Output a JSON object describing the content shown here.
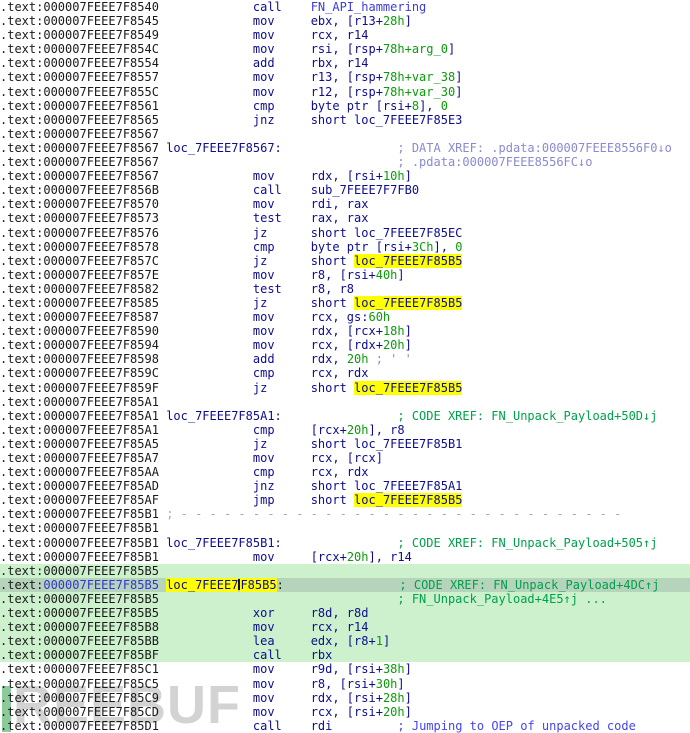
{
  "watermark": {
    "text": "REEBUF"
  },
  "colors": {
    "mnemonic": "#0d0d8e",
    "number": "#0a9b0a",
    "user_name": "#3d3dd3",
    "auto_xref": "#8a8ad0",
    "code_xref": "#00a14b",
    "manual_comment": "#4545ef",
    "highlight_bg": "#ffff00",
    "row_highlight": "#cdf1cd",
    "current_row": "#b6d4bc"
  },
  "listing": {
    "lines": [
      {
        "addr": ".text:000007FEEE7F8540",
        "mnem": "call",
        "ops": [
          [
            "FN_API_hammering",
            "u"
          ]
        ]
      },
      {
        "addr": ".text:000007FEEE7F8545",
        "mnem": "mov",
        "ops": [
          [
            "ebx, [r13+",
            "m"
          ],
          [
            "28h",
            "n"
          ],
          [
            "]",
            "m"
          ]
        ]
      },
      {
        "addr": ".text:000007FEEE7F8549",
        "mnem": "mov",
        "ops": [
          [
            "rcx, r14",
            "m"
          ]
        ]
      },
      {
        "addr": ".text:000007FEEE7F854C",
        "mnem": "mov",
        "ops": [
          [
            "rsi, [rsp+",
            "m"
          ],
          [
            "78h+arg_0",
            "n"
          ],
          [
            "]",
            "m"
          ]
        ]
      },
      {
        "addr": ".text:000007FEEE7F8554",
        "mnem": "add",
        "ops": [
          [
            "rbx, r14",
            "m"
          ]
        ]
      },
      {
        "addr": ".text:000007FEEE7F8557",
        "mnem": "mov",
        "ops": [
          [
            "r13, [rsp+",
            "m"
          ],
          [
            "78h+var_38",
            "n"
          ],
          [
            "]",
            "m"
          ]
        ]
      },
      {
        "addr": ".text:000007FEEE7F855C",
        "mnem": "mov",
        "ops": [
          [
            "r12, [rsp+",
            "m"
          ],
          [
            "78h+var_30",
            "n"
          ],
          [
            "]",
            "m"
          ]
        ]
      },
      {
        "addr": ".text:000007FEEE7F8561",
        "mnem": "cmp",
        "ops": [
          [
            "byte ptr [rsi+",
            "m"
          ],
          [
            "8",
            "n"
          ],
          [
            "], ",
            "m"
          ],
          [
            "0",
            "n"
          ]
        ]
      },
      {
        "addr": ".text:000007FEEE7F8565",
        "mnem": "jnz",
        "ops": [
          [
            "short loc_7FEEE7F85E3",
            "m"
          ]
        ]
      },
      {
        "addr": ".text:000007FEEE7F8567"
      },
      {
        "addr": ".text:000007FEEE7F8567",
        "label": [
          [
            "loc_7FEEE7F8567:",
            "m"
          ]
        ],
        "cmt": [
          [
            "; DATA XREF: .pdata:000007FEEE8556F0↓o",
            "x"
          ]
        ]
      },
      {
        "addr": ".text:000007FEEE7F8567",
        "cmt": [
          [
            "; .pdata:000007FEEE8556FC↓o",
            "x"
          ]
        ]
      },
      {
        "addr": ".text:000007FEEE7F8567",
        "mnem": "mov",
        "ops": [
          [
            "rdx, [rsi+",
            "m"
          ],
          [
            "10h",
            "n"
          ],
          [
            "]",
            "m"
          ]
        ]
      },
      {
        "addr": ".text:000007FEEE7F856B",
        "mnem": "call",
        "ops": [
          [
            "sub_7FEEE7F7FB0",
            "m"
          ]
        ]
      },
      {
        "addr": ".text:000007FEEE7F8570",
        "mnem": "mov",
        "ops": [
          [
            "rdi, rax",
            "m"
          ]
        ]
      },
      {
        "addr": ".text:000007FEEE7F8573",
        "mnem": "test",
        "ops": [
          [
            "rax, rax",
            "m"
          ]
        ]
      },
      {
        "addr": ".text:000007FEEE7F8576",
        "mnem": "jz",
        "ops": [
          [
            "short loc_7FEEE7F85EC",
            "m"
          ]
        ]
      },
      {
        "addr": ".text:000007FEEE7F8578",
        "mnem": "cmp",
        "ops": [
          [
            "byte ptr [rsi+",
            "m"
          ],
          [
            "3Ch",
            "n"
          ],
          [
            "], ",
            "m"
          ],
          [
            "0",
            "n"
          ]
        ]
      },
      {
        "addr": ".text:000007FEEE7F857C",
        "mnem": "jz",
        "ops": [
          [
            "short ",
            "m"
          ],
          [
            "loc_7FEEE7F85B5",
            "hl"
          ]
        ]
      },
      {
        "addr": ".text:000007FEEE7F857E",
        "mnem": "mov",
        "ops": [
          [
            "r8, [rsi+",
            "m"
          ],
          [
            "40h",
            "n"
          ],
          [
            "]",
            "m"
          ]
        ]
      },
      {
        "addr": ".text:000007FEEE7F8582",
        "mnem": "test",
        "ops": [
          [
            "r8, r8",
            "m"
          ]
        ]
      },
      {
        "addr": ".text:000007FEEE7F8585",
        "mnem": "jz",
        "ops": [
          [
            "short ",
            "m"
          ],
          [
            "loc_7FEEE7F85B5",
            "hl"
          ]
        ]
      },
      {
        "addr": ".text:000007FEEE7F8587",
        "mnem": "mov",
        "ops": [
          [
            "rcx, gs:",
            "m"
          ],
          [
            "60h",
            "n"
          ]
        ]
      },
      {
        "addr": ".text:000007FEEE7F8590",
        "mnem": "mov",
        "ops": [
          [
            "rdx, [rcx+",
            "m"
          ],
          [
            "18h",
            "n"
          ],
          [
            "]",
            "m"
          ]
        ]
      },
      {
        "addr": ".text:000007FEEE7F8594",
        "mnem": "mov",
        "ops": [
          [
            "rcx, [rdx+",
            "m"
          ],
          [
            "20h",
            "n"
          ],
          [
            "]",
            "m"
          ]
        ]
      },
      {
        "addr": ".text:000007FEEE7F8598",
        "mnem": "add",
        "ops": [
          [
            "rdx, ",
            "m"
          ],
          [
            "20h",
            "n"
          ],
          [
            " ",
            "m"
          ],
          [
            "; ' '",
            "x"
          ]
        ]
      },
      {
        "addr": ".text:000007FEEE7F859C",
        "mnem": "cmp",
        "ops": [
          [
            "rcx, rdx",
            "m"
          ]
        ]
      },
      {
        "addr": ".text:000007FEEE7F859F",
        "mnem": "jz",
        "ops": [
          [
            "short ",
            "m"
          ],
          [
            "loc_7FEEE7F85B5",
            "hl"
          ]
        ]
      },
      {
        "addr": ".text:000007FEEE7F85A1"
      },
      {
        "addr": ".text:000007FEEE7F85A1",
        "label": [
          [
            "loc_7FEEE7F85A1:",
            "m"
          ]
        ],
        "cmt": [
          [
            "; CODE XREF: FN_Unpack_Payload+50D↓j",
            "g"
          ]
        ]
      },
      {
        "addr": ".text:000007FEEE7F85A1",
        "mnem": "cmp",
        "ops": [
          [
            "[rcx+",
            "m"
          ],
          [
            "20h",
            "n"
          ],
          [
            "], r8",
            "m"
          ]
        ]
      },
      {
        "addr": ".text:000007FEEE7F85A5",
        "mnem": "jz",
        "ops": [
          [
            "short loc_7FEEE7F85B1",
            "m"
          ]
        ]
      },
      {
        "addr": ".text:000007FEEE7F85A7",
        "mnem": "mov",
        "ops": [
          [
            "rcx, [rcx]",
            "m"
          ]
        ]
      },
      {
        "addr": ".text:000007FEEE7F85AA",
        "mnem": "cmp",
        "ops": [
          [
            "rcx, rdx",
            "m"
          ]
        ]
      },
      {
        "addr": ".text:000007FEEE7F85AD",
        "mnem": "jnz",
        "ops": [
          [
            "short loc_7FEEE7F85A1",
            "m"
          ]
        ]
      },
      {
        "addr": ".text:000007FEEE7F85AF",
        "mnem": "jmp",
        "ops": [
          [
            "short ",
            "m"
          ],
          [
            "loc_7FEEE7F85B5",
            "hl"
          ]
        ]
      },
      {
        "addr": ".text:000007FEEE7F85B1",
        "label": [
          [
            "; - - - - - - - - - - - - - - - - - - - - - - - - - - - - - - - ",
            "s"
          ]
        ]
      },
      {
        "addr": ".text:000007FEEE7F85B1"
      },
      {
        "addr": ".text:000007FEEE7F85B1",
        "label": [
          [
            "loc_7FEEE7F85B1:",
            "m"
          ]
        ],
        "cmt": [
          [
            "; CODE XREF: FN_Unpack_Payload+505↑j",
            "g"
          ]
        ]
      },
      {
        "addr": ".text:000007FEEE7F85B1",
        "mnem": "mov",
        "ops": [
          [
            "[rcx+",
            "m"
          ],
          [
            "20h",
            "n"
          ],
          [
            "], r14",
            "m"
          ]
        ]
      },
      {
        "addr": ".text:000007FEEE7F85B5",
        "bg": "g"
      },
      {
        "addr": ".text:000007FEEE7F85B5",
        "cur": true,
        "bg": "c",
        "label": [
          [
            "loc_7FEEE7",
            "hl"
          ],
          [
            "",
            "caret"
          ],
          [
            "F85B5",
            "hl"
          ],
          [
            ":",
            "k"
          ]
        ],
        "cmt": [
          [
            "; CODE XREF: FN_Unpack_Payload+4DC↑j",
            "g"
          ]
        ]
      },
      {
        "addr": ".text:000007FEEE7F85B5",
        "bg": "g",
        "cmt": [
          [
            "; FN_Unpack_Payload+4E5↑j ...",
            "g"
          ]
        ]
      },
      {
        "addr": ".text:000007FEEE7F85B5",
        "bg": "g",
        "mnem": "xor",
        "ops": [
          [
            "r8d, r8d",
            "m"
          ]
        ]
      },
      {
        "addr": ".text:000007FEEE7F85B8",
        "bg": "g",
        "mnem": "mov",
        "ops": [
          [
            "rcx, r14",
            "m"
          ]
        ]
      },
      {
        "addr": ".text:000007FEEE7F85BB",
        "bg": "g",
        "mnem": "lea",
        "ops": [
          [
            "edx, [r8+",
            "m"
          ],
          [
            "1",
            "n"
          ],
          [
            "]",
            "m"
          ]
        ]
      },
      {
        "addr": ".text:000007FEEE7F85BF",
        "bg": "g",
        "mnem": "call",
        "ops": [
          [
            "rbx",
            "m"
          ]
        ]
      },
      {
        "addr": ".text:000007FEEE7F85C1",
        "mnem": "mov",
        "ops": [
          [
            "r9d, [rsi+",
            "m"
          ],
          [
            "38h",
            "n"
          ],
          [
            "]",
            "m"
          ]
        ]
      },
      {
        "addr": ".text:000007FEEE7F85C5",
        "mnem": "mov",
        "ops": [
          [
            "r8, [rsi+",
            "m"
          ],
          [
            "30h",
            "n"
          ],
          [
            "]",
            "m"
          ]
        ]
      },
      {
        "addr": ".text:000007FEEE7F85C9",
        "mnem": "mov",
        "ops": [
          [
            "rdx, [rsi+",
            "m"
          ],
          [
            "28h",
            "n"
          ],
          [
            "]",
            "m"
          ]
        ]
      },
      {
        "addr": ".text:000007FEEE7F85CD",
        "mnem": "mov",
        "ops": [
          [
            "rcx, [rsi+",
            "m"
          ],
          [
            "20h",
            "n"
          ],
          [
            "]",
            "m"
          ]
        ]
      },
      {
        "addr": ".text:000007FEEE7F85D1",
        "mnem": "call",
        "ops": [
          [
            "rdi",
            "m"
          ]
        ],
        "cmt": [
          [
            "; Jumping to OEP of unpacked code",
            "c"
          ]
        ]
      }
    ]
  }
}
